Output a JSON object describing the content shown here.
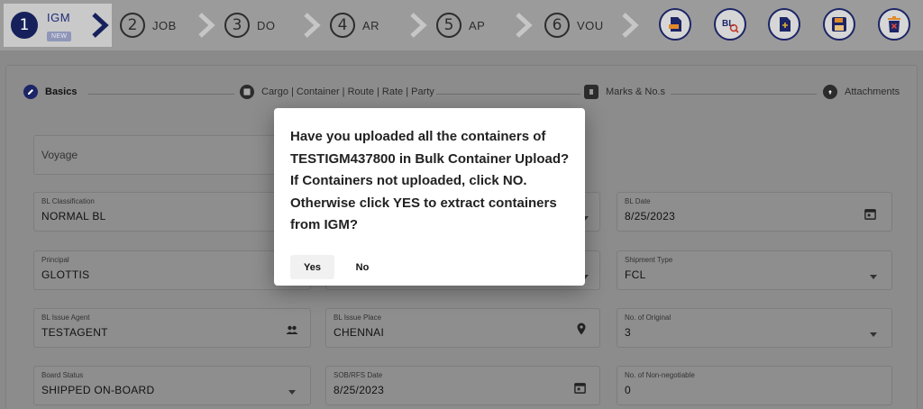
{
  "stepper": {
    "steps": [
      {
        "num": "1",
        "label": "IGM",
        "badge": "NEW"
      },
      {
        "num": "2",
        "label": "JOB"
      },
      {
        "num": "3",
        "label": "DO"
      },
      {
        "num": "4",
        "label": "AR"
      },
      {
        "num": "5",
        "label": "AP"
      },
      {
        "num": "6",
        "label": "VOU"
      }
    ],
    "toolbar_icons": [
      "document-export-icon",
      "bl-search-icon",
      "add-document-icon",
      "save-icon",
      "delete-icon"
    ],
    "toolbar_bl_text": "BL",
    "accent": "#16215c"
  },
  "tabs": [
    {
      "label": "Basics",
      "icon": "pencil-icon"
    },
    {
      "label": "Cargo | Container | Route | Rate | Party",
      "icon": "grid-icon"
    },
    {
      "label": "Marks & No.s",
      "icon": "list-icon"
    },
    {
      "label": "Attachments",
      "icon": "cloud-upload-icon"
    }
  ],
  "form": {
    "voyage": {
      "placeholder": "Voyage"
    },
    "bl_classification": {
      "label": "BL Classification",
      "value": "NORMAL BL"
    },
    "bl_date": {
      "label": "BL Date",
      "value": "8/25/2023"
    },
    "principal": {
      "label": "Principal",
      "value": "GLOTTIS"
    },
    "shipment_type": {
      "label": "Shipment Type",
      "value": "FCL"
    },
    "bl_issue_agent": {
      "label": "BL Issue Agent",
      "value": "TESTAGENT"
    },
    "bl_issue_place": {
      "label": "BL Issue Place",
      "value": "CHENNAI"
    },
    "no_of_original": {
      "label": "No. of Original",
      "value": "3"
    },
    "board_status": {
      "label": "Board Status",
      "value": "SHIPPED ON-BOARD"
    },
    "sob_rfs_date": {
      "label": "SOB/RFS Date",
      "value": "8/25/2023"
    },
    "no_of_non_negotiable": {
      "label": "No. of Non-negotiable",
      "value": "0"
    }
  },
  "dialog": {
    "line1": "Have you uploaded all the containers of",
    "line2": "TESTIGM437800 in Bulk Container Upload?",
    "line3": "If Containers not uploaded, click NO.",
    "line4": "Otherwise click YES to extract containers",
    "line5": "from IGM?",
    "yes_label": "Yes",
    "no_label": "No"
  }
}
